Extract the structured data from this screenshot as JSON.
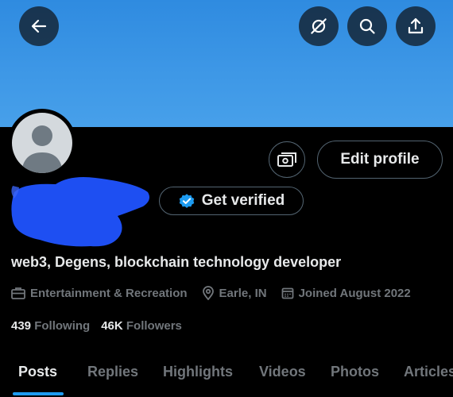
{
  "header": {
    "back_icon": "arrow-left-icon",
    "icons": [
      "satellite-hide-icon",
      "search-icon",
      "share-icon"
    ]
  },
  "profile": {
    "avatar": "default-avatar",
    "edit_profile_label": "Edit profile",
    "get_verified_label": "Get verified",
    "verified_color": "#1d9bf0",
    "bio": "web3, Degens, blockchain technology developer",
    "category": "Entertainment & Recreation",
    "location": "Earle, IN",
    "joined": "Joined August 2022",
    "following_count": "439",
    "following_label": "Following",
    "followers_count": "46K",
    "followers_label": "Followers"
  },
  "tabs": [
    {
      "label": "Posts",
      "active": true
    },
    {
      "label": "Replies",
      "active": false
    },
    {
      "label": "Highlights",
      "active": false
    },
    {
      "label": "Videos",
      "active": false
    },
    {
      "label": "Photos",
      "active": false
    },
    {
      "label": "Articles",
      "active": false
    }
  ],
  "colors": {
    "banner": "#3d97e6",
    "background": "#000000",
    "accent": "#1d9bf0",
    "muted_text": "#71767b"
  }
}
